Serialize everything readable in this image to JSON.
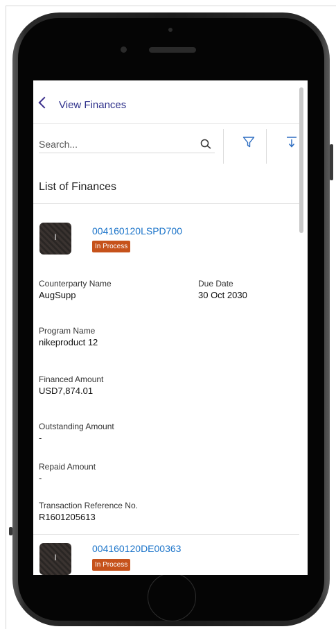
{
  "header": {
    "title": "View Finances"
  },
  "search": {
    "placeholder": "Search..."
  },
  "list": {
    "title": "List of Finances"
  },
  "finances": [
    {
      "reference": "004160120LSPD700",
      "avatar_letter": "I",
      "status": "In Process",
      "counterparty_label": "Counterparty Name",
      "counterparty_value": "AugSupp",
      "due_date_label": "Due Date",
      "due_date_value": "30 Oct 2030",
      "program_label": "Program Name",
      "program_value": "nikeproduct 12",
      "financed_label": "Financed Amount",
      "financed_value": "USD7,874.01",
      "outstanding_label": "Outstanding Amount",
      "outstanding_value": "-",
      "repaid_label": "Repaid Amount",
      "repaid_value": "-",
      "txn_ref_label": "Transaction Reference No.",
      "txn_ref_value": "R1601205613"
    },
    {
      "reference": "004160120DE00363",
      "avatar_letter": "I",
      "status": "In Process"
    }
  ],
  "colors": {
    "accent": "#2c2f8a",
    "link": "#1a73c9",
    "status_badge": "#c6521b"
  }
}
